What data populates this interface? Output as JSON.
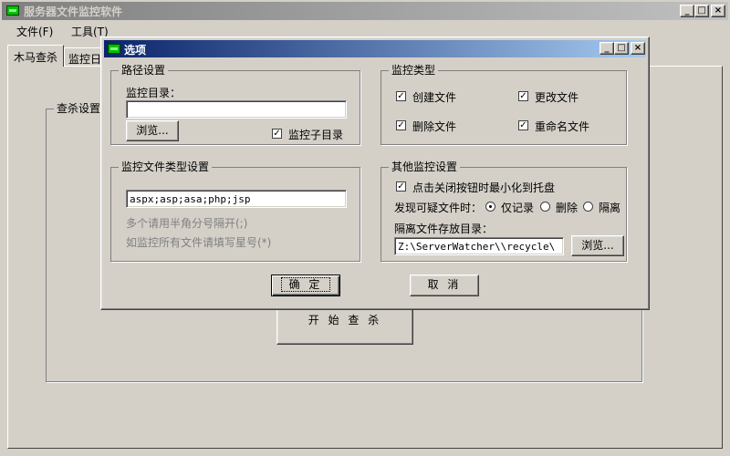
{
  "main_window": {
    "title": "服务器文件监控软件",
    "menu": [
      "文件(F)",
      "工具(T)"
    ],
    "tabs": [
      "木马查杀",
      "监控日"
    ],
    "scan_group_title": "查杀设置",
    "start_button": "开 始 查 杀",
    "caption_buttons": [
      "_",
      "□",
      "×"
    ]
  },
  "dialog": {
    "title": "选项",
    "caption_buttons": [
      "_",
      "□",
      "×"
    ],
    "path_group": {
      "title": "路径设置",
      "dir_label": "监控目录：",
      "dir_value": "",
      "browse": "浏览...",
      "subdir_label": "监控子目录",
      "subdir_checked": true
    },
    "type_group": {
      "title": "监控类型",
      "items": [
        {
          "label": "创建文件",
          "checked": true
        },
        {
          "label": "更改文件",
          "checked": true
        },
        {
          "label": "删除文件",
          "checked": true
        },
        {
          "label": "重命名文件",
          "checked": true
        }
      ]
    },
    "filetype_group": {
      "title": "监控文件类型设置",
      "value": "aspx;asp;asa;php;jsp",
      "hint1": "多个请用半角分号隔开(;)",
      "hint2": "如监控所有文件请填写星号(*)"
    },
    "other_group": {
      "title": "其他监控设置",
      "minimize_label": "点击关闭按钮时最小化到托盘",
      "minimize_checked": true,
      "suspicious_label": "发现可疑文件时：",
      "options": [
        {
          "label": "仅记录",
          "selected": true
        },
        {
          "label": "删除",
          "selected": false
        },
        {
          "label": "隔离",
          "selected": false
        }
      ],
      "quarantine_label": "隔离文件存放目录：",
      "quarantine_value": "Z:\\ServerWatcher\\\\recycle\\",
      "browse": "浏览..."
    },
    "ok": "确 定",
    "cancel": "取 消"
  }
}
